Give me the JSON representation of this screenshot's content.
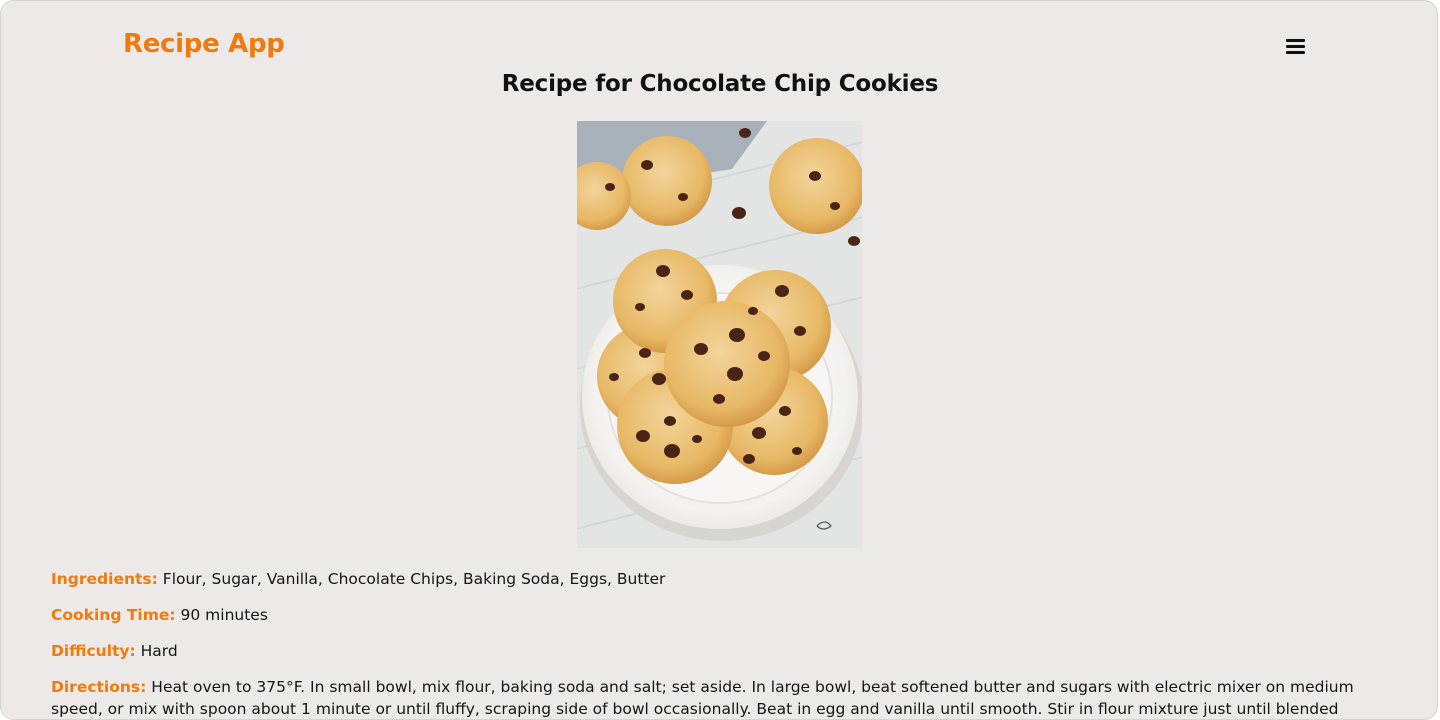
{
  "header": {
    "brand": "Recipe App",
    "menu_icon": "hamburger-menu-icon"
  },
  "recipe": {
    "title": "Recipe for Chocolate Chip Cookies",
    "image": {
      "semantic": "chocolate-chip-cookies-photo"
    },
    "ingredients_label": "Ingredients:",
    "ingredients": "Flour, Sugar, Vanilla, Chocolate Chips, Baking Soda, Eggs, Butter",
    "cooking_time_label": "Cooking Time:",
    "cooking_time": "90 minutes",
    "difficulty_label": "Difficulty:",
    "difficulty": "Hard",
    "directions_label": "Directions:",
    "directions": "Heat oven to 375°F. In small bowl, mix flour, baking soda and salt; set aside. In large bowl, beat softened butter and sugars with electric mixer on medium speed, or mix with spoon about 1 minute or until fluffy, scraping side of bowl occasionally. Beat in egg and vanilla until smooth. Stir in flour mixture just until blended (dough will be stiff). Stir in chocolate"
  },
  "colors": {
    "accent": "#f07a0b",
    "background": "#ede9e9",
    "text": "#151515"
  }
}
